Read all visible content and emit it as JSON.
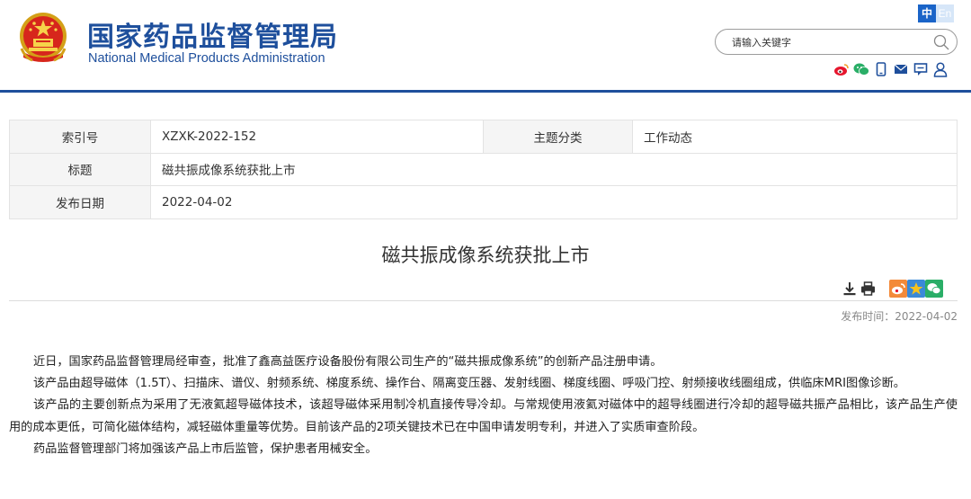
{
  "header": {
    "logo_cn": "国家药品监督管理局",
    "logo_en": "National Medical Products Administration",
    "lang_cn": "中",
    "lang_en": "En",
    "search_placeholder": "请输入关键字",
    "share_icons": [
      "weibo-icon",
      "wechat-icon",
      "mobile-icon",
      "mail-icon",
      "message-icon",
      "user-icon"
    ]
  },
  "meta": {
    "index_label": "索引号",
    "index_value": "XZXK-2022-152",
    "category_label": "主题分类",
    "category_value": "工作动态",
    "title_label": "标题",
    "title_value": "磁共振成像系统获批上市",
    "date_label": "发布日期",
    "date_value": "2022-04-02"
  },
  "article": {
    "title": "磁共振成像系统获批上市",
    "publish_label": "发布时间：",
    "publish_date": "2022-04-02",
    "paragraphs": [
      "近日，国家药品监督管理局经审查，批准了鑫高益医疗设备股份有限公司生产的“磁共振成像系统”的创新产品注册申请。",
      "该产品由超导磁体（1.5T）、扫描床、谱仪、射频系统、梯度系统、操作台、隔离变压器、发射线圈、梯度线圈、呼吸门控、射频接收线圈组成，供临床MRI图像诊断。",
      "该产品的主要创新点为采用了无液氦超导磁体技术，该超导磁体采用制冷机直接传导冷却。与常规使用液氦对磁体中的超导线圈进行冷却的超导磁共振产品相比，该产品生产使用的成本更低，可简化磁体结构，减轻磁体重量等优势。目前该产品的2项关键技术已在中国申请发明专利，并进入了实质审查阶段。",
      "药品监督管理部门将加强该产品上市后监管，保护患者用械安全。"
    ]
  },
  "tools": [
    "download-icon",
    "print-icon",
    "weibo-share-icon",
    "favorite-icon",
    "wechat-share-icon"
  ],
  "colors": {
    "brand": "#1e4f9c",
    "lang_active": "#1a64c8",
    "share_red": "#e6162d",
    "share_green": "#2aae67",
    "share_orange": "#f3a02c"
  }
}
